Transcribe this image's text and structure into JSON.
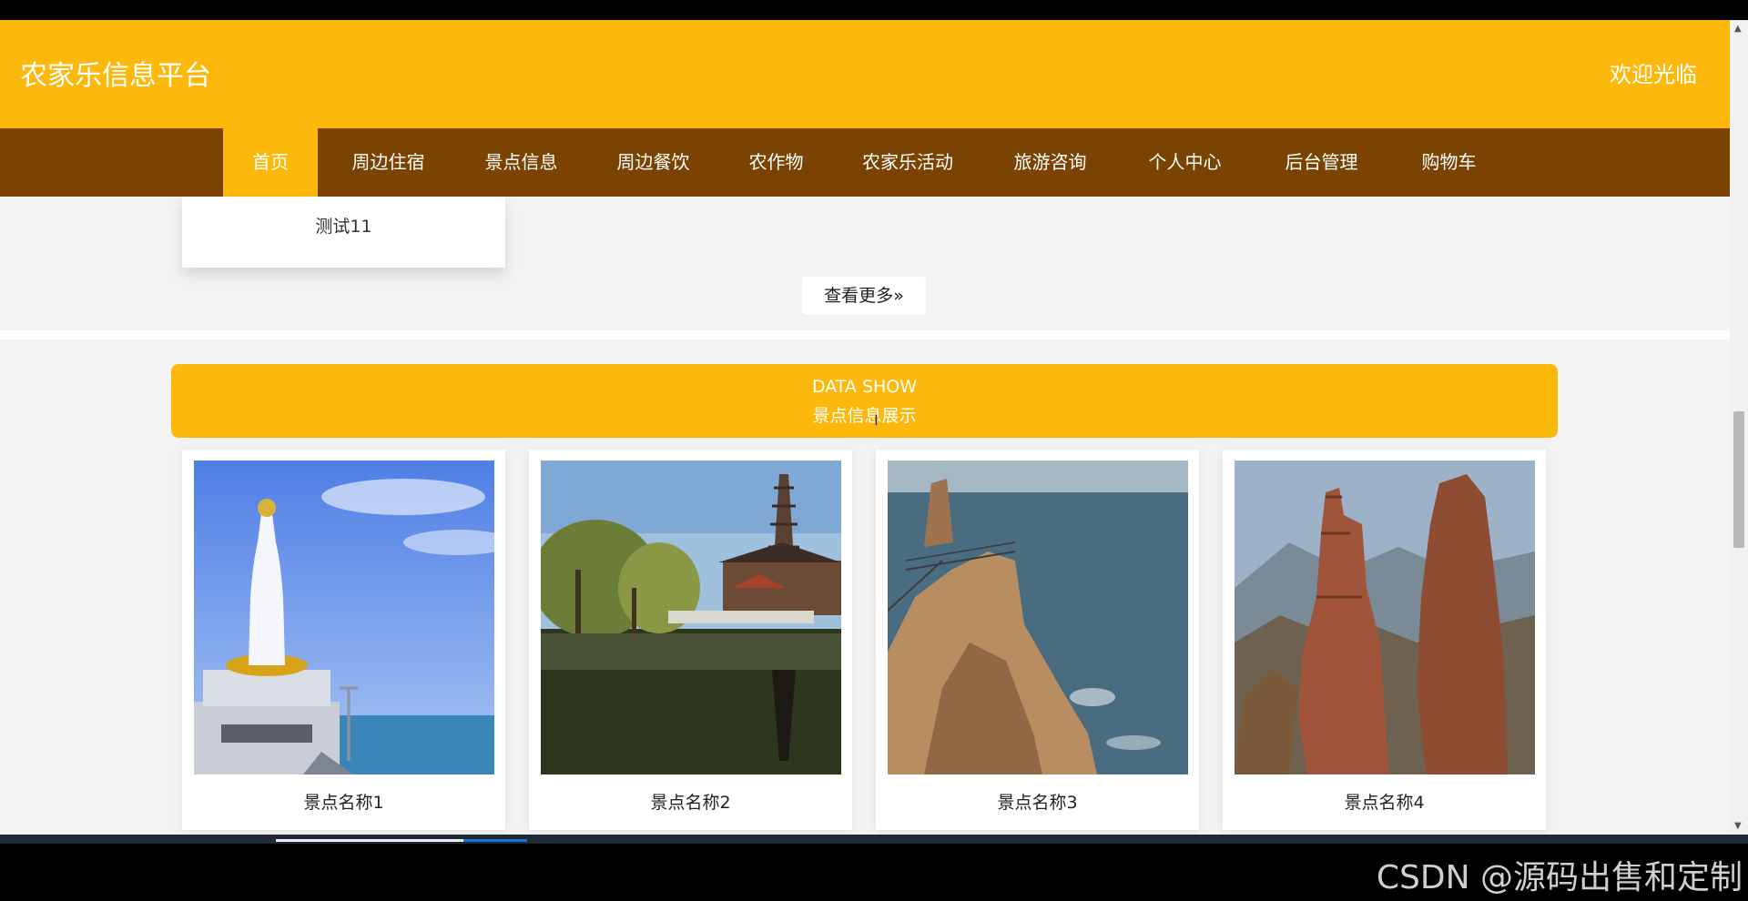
{
  "header": {
    "title": "农家乐信息平台",
    "welcome": "欢迎光临"
  },
  "nav": {
    "active_index": 0,
    "items": [
      "首页",
      "周边住宿",
      "景点信息",
      "周边餐饮",
      "农作物",
      "农家乐活动",
      "旅游咨询",
      "个人中心",
      "后台管理",
      "购物车"
    ]
  },
  "previous_section": {
    "card_title": "测试11",
    "more_button": "查看更多"
  },
  "data_show": {
    "title_en": "DATA SHOW",
    "title_cn": "景点信息展示",
    "cards": [
      {
        "name": "景点名称1",
        "image": "guanyin-statue-by-sea"
      },
      {
        "name": "景点名称2",
        "image": "pagoda-lake-reflection"
      },
      {
        "name": "景点名称3",
        "image": "sea-cliff-walkway"
      },
      {
        "name": "景点名称4",
        "image": "red-rock-pillars"
      }
    ]
  },
  "watermark": "CSDN @源码出售和定制",
  "colors": {
    "header": "#fdb80c",
    "nav": "#7a4302",
    "page_bg": "#f3f3f3"
  }
}
